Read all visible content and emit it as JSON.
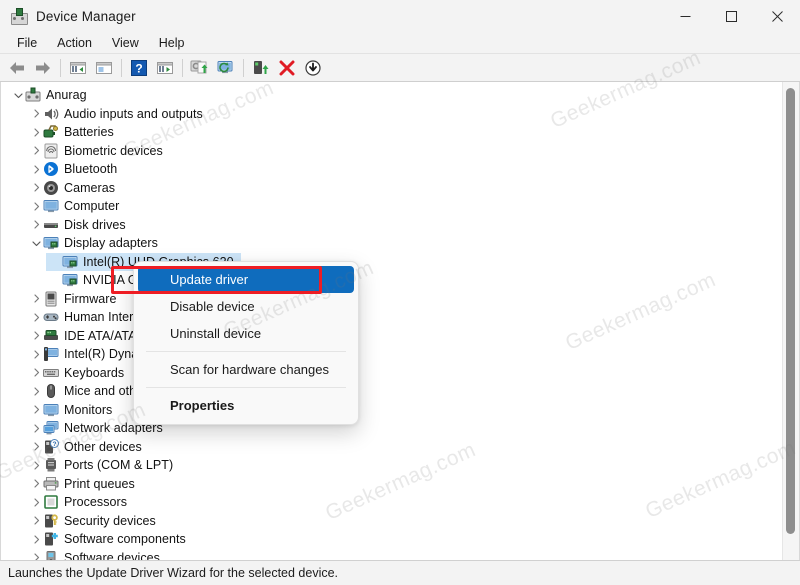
{
  "window": {
    "title": "Device Manager",
    "icon": "device-manager-icon",
    "controls": [
      {
        "name": "minimize-button",
        "glyph": "minimize-icon"
      },
      {
        "name": "maximize-button",
        "glyph": "maximize-icon"
      },
      {
        "name": "close-button",
        "glyph": "close-icon"
      }
    ]
  },
  "menubar": {
    "items": [
      {
        "label": "File"
      },
      {
        "label": "Action"
      },
      {
        "label": "View"
      },
      {
        "label": "Help"
      }
    ]
  },
  "toolbar": {
    "buttons": [
      {
        "name": "back-button",
        "icon": "back-arrow-icon"
      },
      {
        "name": "forward-button",
        "icon": "forward-arrow-icon"
      },
      {
        "name": "up-one-level-button",
        "icon": "up-level-icon"
      },
      {
        "name": "show-hide-console-tree-button",
        "icon": "console-tree-icon"
      },
      {
        "name": "help-button",
        "icon": "question-mark-icon"
      },
      {
        "name": "properties-button",
        "icon": "properties-window-icon"
      },
      {
        "name": "update-driver-button",
        "icon": "update-driver-icon"
      },
      {
        "name": "scan-for-hardware-changes-button",
        "icon": "scan-hardware-icon"
      },
      {
        "name": "enable-device-button",
        "icon": "enable-device-icon"
      },
      {
        "name": "uninstall-device-button",
        "icon": "red-x-icon"
      },
      {
        "name": "disable-device-button",
        "icon": "down-arrow-circle-icon"
      }
    ]
  },
  "tree": {
    "root": {
      "label": "Anurag",
      "icon": "computer-root-icon",
      "expanded": true
    },
    "items": [
      {
        "label": "Audio inputs and outputs",
        "icon": "speaker-icon",
        "expanded": false,
        "level": 1
      },
      {
        "label": "Batteries",
        "icon": "battery-icon",
        "expanded": false,
        "level": 1
      },
      {
        "label": "Biometric devices",
        "icon": "fingerprint-icon",
        "expanded": false,
        "level": 1
      },
      {
        "label": "Bluetooth",
        "icon": "bluetooth-icon",
        "expanded": false,
        "level": 1
      },
      {
        "label": "Cameras",
        "icon": "camera-icon",
        "expanded": false,
        "level": 1
      },
      {
        "label": "Computer",
        "icon": "monitor-icon",
        "expanded": false,
        "level": 1
      },
      {
        "label": "Disk drives",
        "icon": "disk-drive-icon",
        "expanded": false,
        "level": 1
      },
      {
        "label": "Display adapters",
        "icon": "display-adapter-icon",
        "expanded": true,
        "level": 1
      },
      {
        "label": "Intel(R) UHD Graphics 620",
        "icon": "display-adapter-icon",
        "selected": true,
        "level": 2
      },
      {
        "label": "NVIDIA GeForce MX150",
        "icon": "display-adapter-icon",
        "level": 2
      },
      {
        "label": "Firmware",
        "icon": "firmware-icon",
        "expanded": false,
        "level": 1
      },
      {
        "label": "Human Interface Devices",
        "icon": "hid-icon",
        "expanded": false,
        "level": 1
      },
      {
        "label": "IDE ATA/ATAPI controllers",
        "icon": "ide-controller-icon",
        "expanded": false,
        "level": 1
      },
      {
        "label": "Intel(R) Dynamic Platform and Thermal Framework",
        "icon": "intel-platform-icon",
        "expanded": false,
        "level": 1
      },
      {
        "label": "Keyboards",
        "icon": "keyboard-icon",
        "expanded": false,
        "level": 1
      },
      {
        "label": "Mice and other pointing devices",
        "icon": "mouse-icon",
        "expanded": false,
        "level": 1
      },
      {
        "label": "Monitors",
        "icon": "monitor-icon",
        "expanded": false,
        "level": 1
      },
      {
        "label": "Network adapters",
        "icon": "network-adapter-icon",
        "expanded": false,
        "level": 1
      },
      {
        "label": "Other devices",
        "icon": "other-device-icon",
        "expanded": false,
        "level": 1
      },
      {
        "label": "Ports (COM & LPT)",
        "icon": "port-icon",
        "expanded": false,
        "level": 1
      },
      {
        "label": "Print queues",
        "icon": "printer-icon",
        "expanded": false,
        "level": 1
      },
      {
        "label": "Processors",
        "icon": "processor-icon",
        "expanded": false,
        "level": 1
      },
      {
        "label": "Security devices",
        "icon": "security-device-icon",
        "expanded": false,
        "level": 1
      },
      {
        "label": "Software components",
        "icon": "software-component-icon",
        "expanded": false,
        "level": 1
      },
      {
        "label": "Software devices",
        "icon": "software-device-icon",
        "expanded": false,
        "level": 1
      }
    ]
  },
  "context_menu": {
    "items": [
      {
        "label": "Update driver",
        "highlighted": true
      },
      {
        "label": "Disable device"
      },
      {
        "label": "Uninstall device"
      },
      {
        "separator": true
      },
      {
        "label": "Scan for hardware changes"
      },
      {
        "separator": true
      },
      {
        "label": "Properties",
        "bold": true
      }
    ]
  },
  "statusbar": {
    "text": "Launches the Update Driver Wizard for the selected device."
  },
  "watermark": {
    "text": "Geekermag.com"
  },
  "colors": {
    "menu_highlight": "#0f6cbd",
    "annotation_box": "#ee1d24",
    "tree_selection": "#cce4f7",
    "window_bg": "#f3f3f3"
  }
}
